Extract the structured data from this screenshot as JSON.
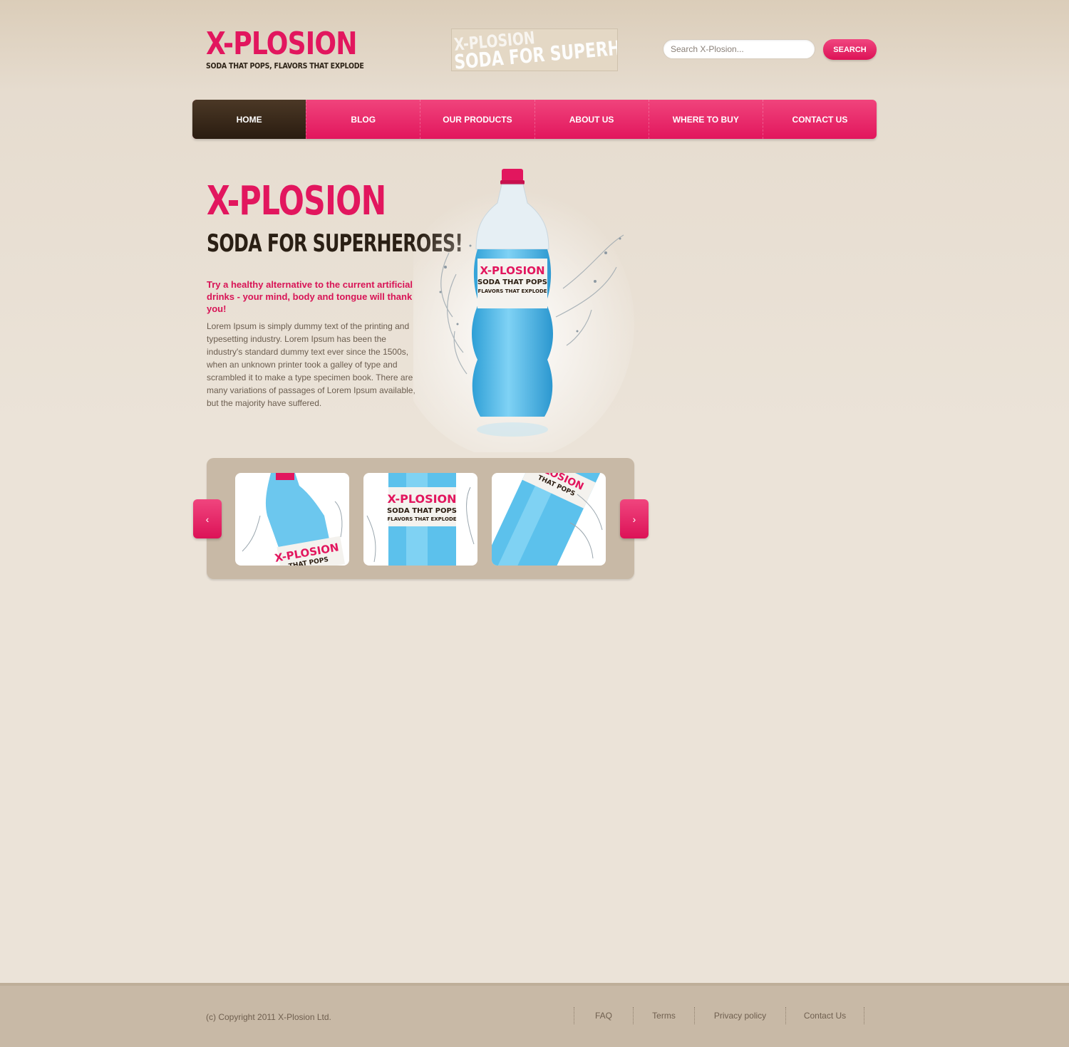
{
  "header": {
    "logo_title": "X-PLOSION",
    "logo_tagline": "SODA THAT POPS, FLAVORS THAT EXPLODE",
    "banner_line1": "X-PLOSION",
    "banner_line2": "SODA FOR SUPERHEROES",
    "search_placeholder": "Search X-Plosion...",
    "search_button": "SEARCH"
  },
  "nav": {
    "items": [
      {
        "label": "HOME",
        "active": true
      },
      {
        "label": "BLOG"
      },
      {
        "label": "OUR PRODUCTS"
      },
      {
        "label": "ABOUT US"
      },
      {
        "label": "WHERE TO BUY"
      },
      {
        "label": "CONTACT US"
      }
    ]
  },
  "hero": {
    "title": "X-PLOSION",
    "subtitle": "SODA FOR SUPERHEROES!",
    "lead": "Try a healthy alternative to the current artificial drinks - your mind, body and tongue will thank you!",
    "body": "Lorem Ipsum is simply dummy text of the printing and typesetting industry. Lorem Ipsum has been the industry's standard dummy text ever since the 1500s, when an unknown printer took a galley of type and scrambled it to make a type specimen book. There are many variations of passages of Lorem Ipsum available, but the majority have suffered.",
    "bottle_label_brand": "X-PLOSION",
    "bottle_label_line1": "SODA THAT POPS",
    "bottle_label_line2": "FLAVORS THAT EXPLODE"
  },
  "carousel": {
    "prev_icon": "chevron-left-icon",
    "next_icon": "chevron-right-icon",
    "prev_glyph": "‹",
    "next_glyph": "›",
    "thumbs": [
      {
        "brand": "X-PLOSION",
        "line1": "THAT POPS"
      },
      {
        "brand": "X-PLOSION",
        "line1": "SODA THAT POPS",
        "line2": "FLAVORS THAT EXPLODE"
      },
      {
        "brand": "PLOSION",
        "line1": "THAT POPS"
      }
    ]
  },
  "footer": {
    "copyright": "(c) Copyright 2011 X-Plosion Ltd.",
    "links": [
      "FAQ",
      "Terms",
      "Privacy policy",
      "Contact Us"
    ]
  },
  "colors": {
    "accent": "#e2165e",
    "dark": "#2a1c10",
    "bottle_blue": "#4cb8e6",
    "panel": "#c8b9a6"
  }
}
